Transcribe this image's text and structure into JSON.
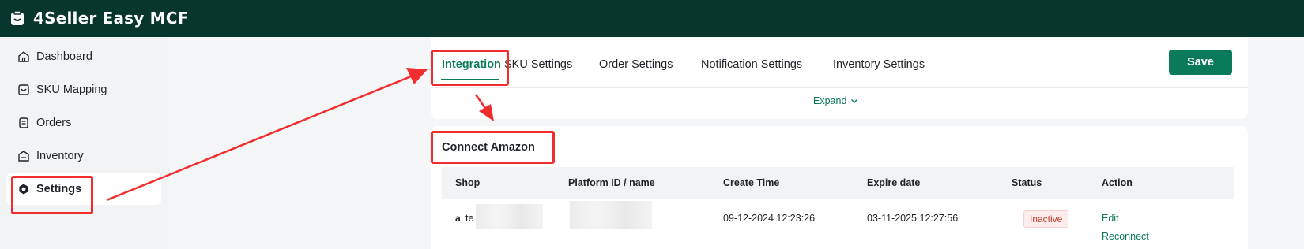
{
  "app": {
    "title": "4Seller Easy MCF"
  },
  "sidebar": {
    "items": [
      {
        "label": "Dashboard",
        "icon": "home-icon"
      },
      {
        "label": "SKU Mapping",
        "icon": "sku-icon"
      },
      {
        "label": "Orders",
        "icon": "orders-icon"
      },
      {
        "label": "Inventory",
        "icon": "inventory-icon"
      },
      {
        "label": "Settings",
        "icon": "settings-icon"
      }
    ]
  },
  "tabs": {
    "items": [
      {
        "label": "Integration",
        "active": true
      },
      {
        "label": "SKU Settings"
      },
      {
        "label": "Order Settings"
      },
      {
        "label": "Notification Settings"
      },
      {
        "label": "Inventory Settings"
      }
    ],
    "save_label": "Save",
    "expand_label": "Expand"
  },
  "connect": {
    "title": "Connect Amazon",
    "columns": [
      "Shop",
      "Platform ID / name",
      "Create Time",
      "Expire date",
      "Status",
      "Action"
    ],
    "rows": [
      {
        "shop_icon": "a",
        "shop_prefix": "te",
        "create_time": "09-12-2024 12:23:26",
        "expire_date": "03-11-2025 12:27:56",
        "status": "Inactive",
        "actions": [
          "Edit",
          "Reconnect"
        ]
      }
    ]
  },
  "colors": {
    "brand": "#07362c",
    "accent": "#0b7a5a",
    "annotation": "#f12d2d"
  }
}
